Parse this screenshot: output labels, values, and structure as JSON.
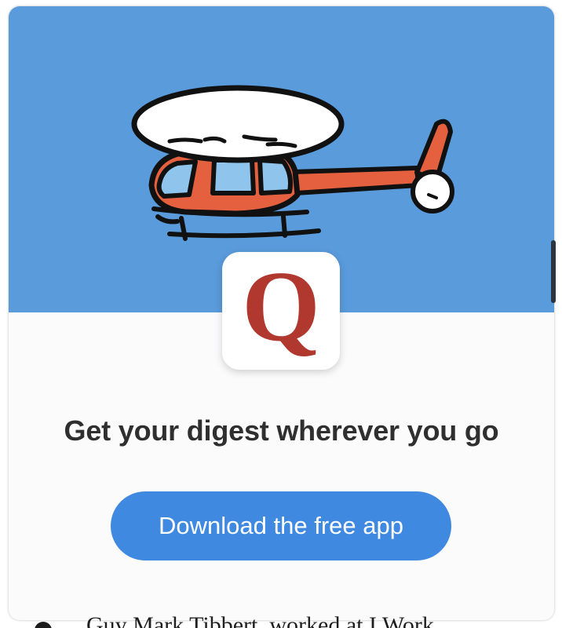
{
  "promo": {
    "illustration": "helicopter-illustration",
    "logo": {
      "letter": "Q",
      "icon": "quora-logo-icon"
    },
    "headline": "Get your digest wherever you go",
    "cta_label": "Download the free app"
  },
  "feed_below": {
    "partial_text": "Guy Mark Tibbert, worked at I Work"
  },
  "colors": {
    "hero_bg": "#5a9bdc",
    "cta_bg": "#3f89e0",
    "brand_red": "#b0382f",
    "card_bg": "#fbfbfc",
    "headline_text": "#2f2f2f"
  }
}
